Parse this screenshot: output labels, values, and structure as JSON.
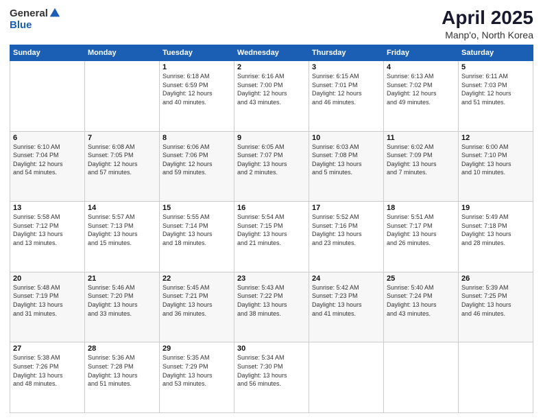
{
  "logo": {
    "general": "General",
    "blue": "Blue"
  },
  "title": "April 2025",
  "subtitle": "Manp'o, North Korea",
  "weekdays": [
    "Sunday",
    "Monday",
    "Tuesday",
    "Wednesday",
    "Thursday",
    "Friday",
    "Saturday"
  ],
  "weeks": [
    [
      {
        "day": "",
        "info": ""
      },
      {
        "day": "",
        "info": ""
      },
      {
        "day": "1",
        "info": "Sunrise: 6:18 AM\nSunset: 6:59 PM\nDaylight: 12 hours\nand 40 minutes."
      },
      {
        "day": "2",
        "info": "Sunrise: 6:16 AM\nSunset: 7:00 PM\nDaylight: 12 hours\nand 43 minutes."
      },
      {
        "day": "3",
        "info": "Sunrise: 6:15 AM\nSunset: 7:01 PM\nDaylight: 12 hours\nand 46 minutes."
      },
      {
        "day": "4",
        "info": "Sunrise: 6:13 AM\nSunset: 7:02 PM\nDaylight: 12 hours\nand 49 minutes."
      },
      {
        "day": "5",
        "info": "Sunrise: 6:11 AM\nSunset: 7:03 PM\nDaylight: 12 hours\nand 51 minutes."
      }
    ],
    [
      {
        "day": "6",
        "info": "Sunrise: 6:10 AM\nSunset: 7:04 PM\nDaylight: 12 hours\nand 54 minutes."
      },
      {
        "day": "7",
        "info": "Sunrise: 6:08 AM\nSunset: 7:05 PM\nDaylight: 12 hours\nand 57 minutes."
      },
      {
        "day": "8",
        "info": "Sunrise: 6:06 AM\nSunset: 7:06 PM\nDaylight: 12 hours\nand 59 minutes."
      },
      {
        "day": "9",
        "info": "Sunrise: 6:05 AM\nSunset: 7:07 PM\nDaylight: 13 hours\nand 2 minutes."
      },
      {
        "day": "10",
        "info": "Sunrise: 6:03 AM\nSunset: 7:08 PM\nDaylight: 13 hours\nand 5 minutes."
      },
      {
        "day": "11",
        "info": "Sunrise: 6:02 AM\nSunset: 7:09 PM\nDaylight: 13 hours\nand 7 minutes."
      },
      {
        "day": "12",
        "info": "Sunrise: 6:00 AM\nSunset: 7:10 PM\nDaylight: 13 hours\nand 10 minutes."
      }
    ],
    [
      {
        "day": "13",
        "info": "Sunrise: 5:58 AM\nSunset: 7:12 PM\nDaylight: 13 hours\nand 13 minutes."
      },
      {
        "day": "14",
        "info": "Sunrise: 5:57 AM\nSunset: 7:13 PM\nDaylight: 13 hours\nand 15 minutes."
      },
      {
        "day": "15",
        "info": "Sunrise: 5:55 AM\nSunset: 7:14 PM\nDaylight: 13 hours\nand 18 minutes."
      },
      {
        "day": "16",
        "info": "Sunrise: 5:54 AM\nSunset: 7:15 PM\nDaylight: 13 hours\nand 21 minutes."
      },
      {
        "day": "17",
        "info": "Sunrise: 5:52 AM\nSunset: 7:16 PM\nDaylight: 13 hours\nand 23 minutes."
      },
      {
        "day": "18",
        "info": "Sunrise: 5:51 AM\nSunset: 7:17 PM\nDaylight: 13 hours\nand 26 minutes."
      },
      {
        "day": "19",
        "info": "Sunrise: 5:49 AM\nSunset: 7:18 PM\nDaylight: 13 hours\nand 28 minutes."
      }
    ],
    [
      {
        "day": "20",
        "info": "Sunrise: 5:48 AM\nSunset: 7:19 PM\nDaylight: 13 hours\nand 31 minutes."
      },
      {
        "day": "21",
        "info": "Sunrise: 5:46 AM\nSunset: 7:20 PM\nDaylight: 13 hours\nand 33 minutes."
      },
      {
        "day": "22",
        "info": "Sunrise: 5:45 AM\nSunset: 7:21 PM\nDaylight: 13 hours\nand 36 minutes."
      },
      {
        "day": "23",
        "info": "Sunrise: 5:43 AM\nSunset: 7:22 PM\nDaylight: 13 hours\nand 38 minutes."
      },
      {
        "day": "24",
        "info": "Sunrise: 5:42 AM\nSunset: 7:23 PM\nDaylight: 13 hours\nand 41 minutes."
      },
      {
        "day": "25",
        "info": "Sunrise: 5:40 AM\nSunset: 7:24 PM\nDaylight: 13 hours\nand 43 minutes."
      },
      {
        "day": "26",
        "info": "Sunrise: 5:39 AM\nSunset: 7:25 PM\nDaylight: 13 hours\nand 46 minutes."
      }
    ],
    [
      {
        "day": "27",
        "info": "Sunrise: 5:38 AM\nSunset: 7:26 PM\nDaylight: 13 hours\nand 48 minutes."
      },
      {
        "day": "28",
        "info": "Sunrise: 5:36 AM\nSunset: 7:28 PM\nDaylight: 13 hours\nand 51 minutes."
      },
      {
        "day": "29",
        "info": "Sunrise: 5:35 AM\nSunset: 7:29 PM\nDaylight: 13 hours\nand 53 minutes."
      },
      {
        "day": "30",
        "info": "Sunrise: 5:34 AM\nSunset: 7:30 PM\nDaylight: 13 hours\nand 56 minutes."
      },
      {
        "day": "",
        "info": ""
      },
      {
        "day": "",
        "info": ""
      },
      {
        "day": "",
        "info": ""
      }
    ]
  ]
}
